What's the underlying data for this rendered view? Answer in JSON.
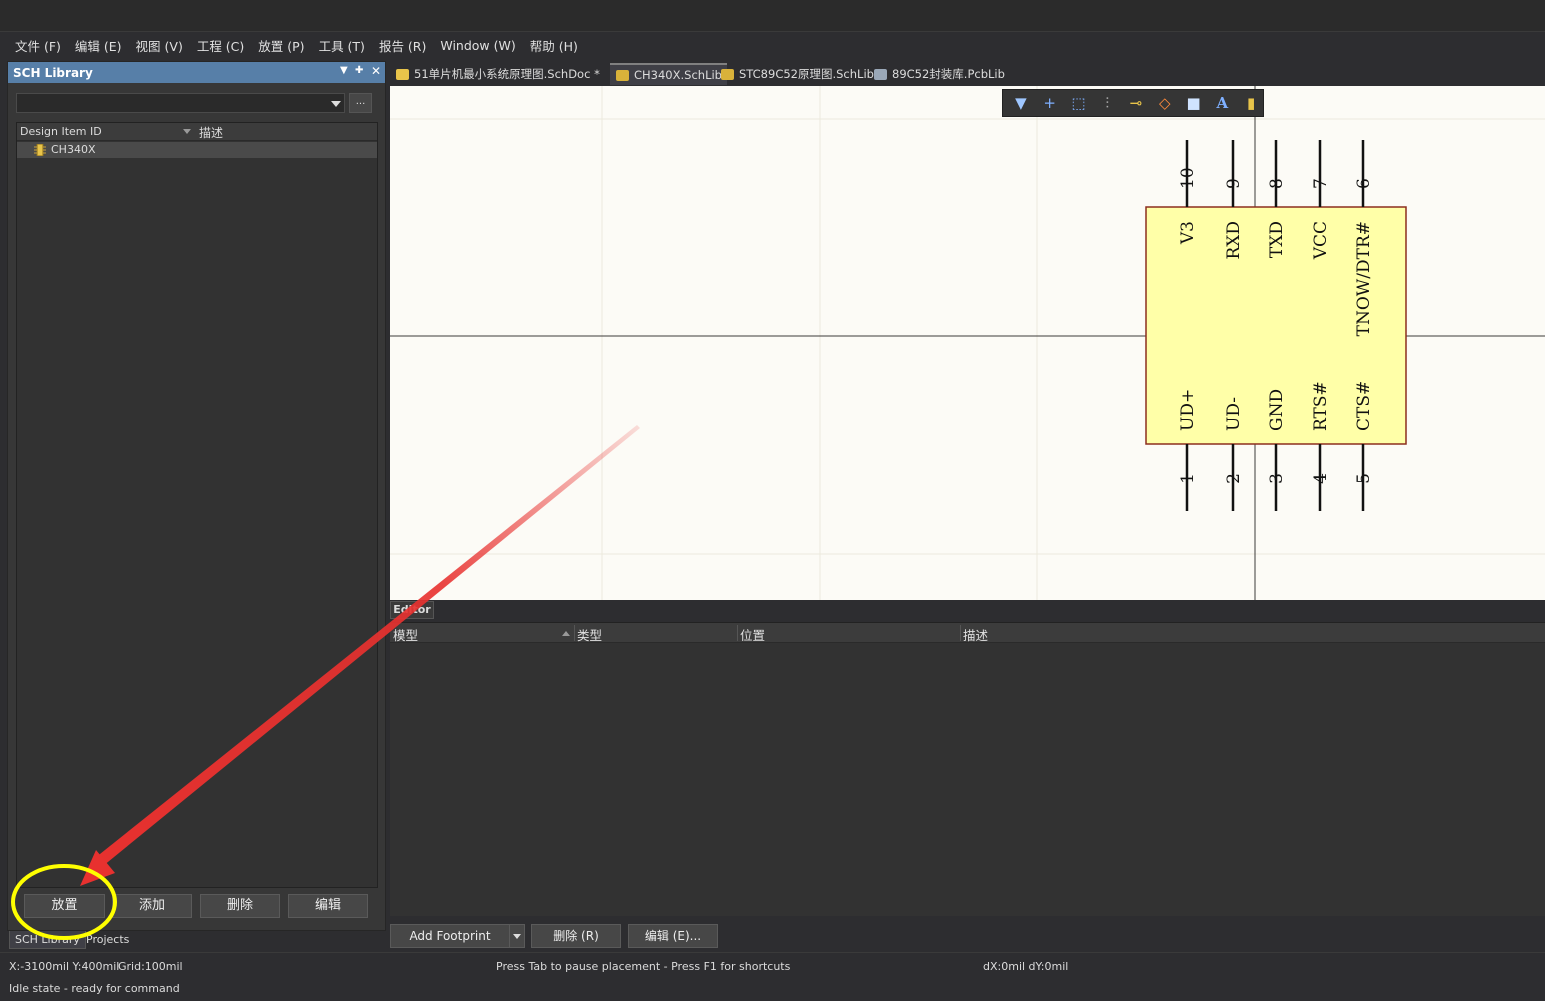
{
  "menu": [
    "文件 (F)",
    "编辑 (E)",
    "视图 (V)",
    "工程 (C)",
    "放置 (P)",
    "工具 (T)",
    "报告 (R)",
    "Window (W)",
    "帮助 (H)"
  ],
  "panel": {
    "title": "SCH Library",
    "ellipsis": "...",
    "columns": {
      "id": "Design Item ID",
      "desc": "描述"
    },
    "items": [
      {
        "id": "CH340X",
        "desc": ""
      }
    ],
    "buttons": {
      "place": "放置",
      "add": "添加",
      "delete": "删除",
      "edit": "编辑"
    },
    "bottom_tabs": [
      "SCH Library",
      "Projects"
    ]
  },
  "doc_tabs": [
    {
      "label": "51单片机最小系统原理图.SchDoc *",
      "icon": "schdoc-icon",
      "color": "#e8c44a"
    },
    {
      "label": "CH340X.SchLib",
      "icon": "schlib-icon",
      "color": "#d9b23a"
    },
    {
      "label": "STC89C52原理图.SchLib",
      "icon": "schlib-icon",
      "color": "#d9b23a"
    },
    {
      "label": "89C52封装库.PcbLib",
      "icon": "pcblib-icon",
      "color": "#9aa8b8"
    }
  ],
  "toolbar": [
    "filter-icon",
    "cross-icon",
    "select-icon",
    "align-icon",
    "pin-icon",
    "fill-icon",
    "rect-icon",
    "text-icon",
    "component-icon"
  ],
  "component": {
    "fill": "#ffffa8",
    "border": "#8b2e1e",
    "top_pins": [
      {
        "num": "10",
        "name": "V3"
      },
      {
        "num": "9",
        "name": "RXD"
      },
      {
        "num": "8",
        "name": "TXD"
      },
      {
        "num": "7",
        "name": "VCC"
      },
      {
        "num": "6",
        "name": "TNOW/DTR#"
      }
    ],
    "bottom_pins": [
      {
        "num": "1",
        "name": "UD+"
      },
      {
        "num": "2",
        "name": "UD-"
      },
      {
        "num": "3",
        "name": "GND"
      },
      {
        "num": "4",
        "name": "RTS#"
      },
      {
        "num": "5",
        "name": "CTS#"
      }
    ]
  },
  "editor": {
    "tab": "Editor",
    "columns": [
      "模型",
      "类型",
      "位置",
      "描述"
    ],
    "buttons": {
      "add_footprint": "Add Footprint",
      "delete": "删除 (R)",
      "edit": "编辑 (E)..."
    }
  },
  "status": {
    "coords": "X:-3100mil Y:400mil",
    "grid": "Grid:100mil",
    "message": "Press Tab to pause placement - Press F1 for shortcuts",
    "delta": "dX:0mil dY:0mil",
    "state": "Idle state - ready for command"
  },
  "annotation": {
    "highlight_color": "#ffff00",
    "arrow_color": "#e8312f"
  }
}
